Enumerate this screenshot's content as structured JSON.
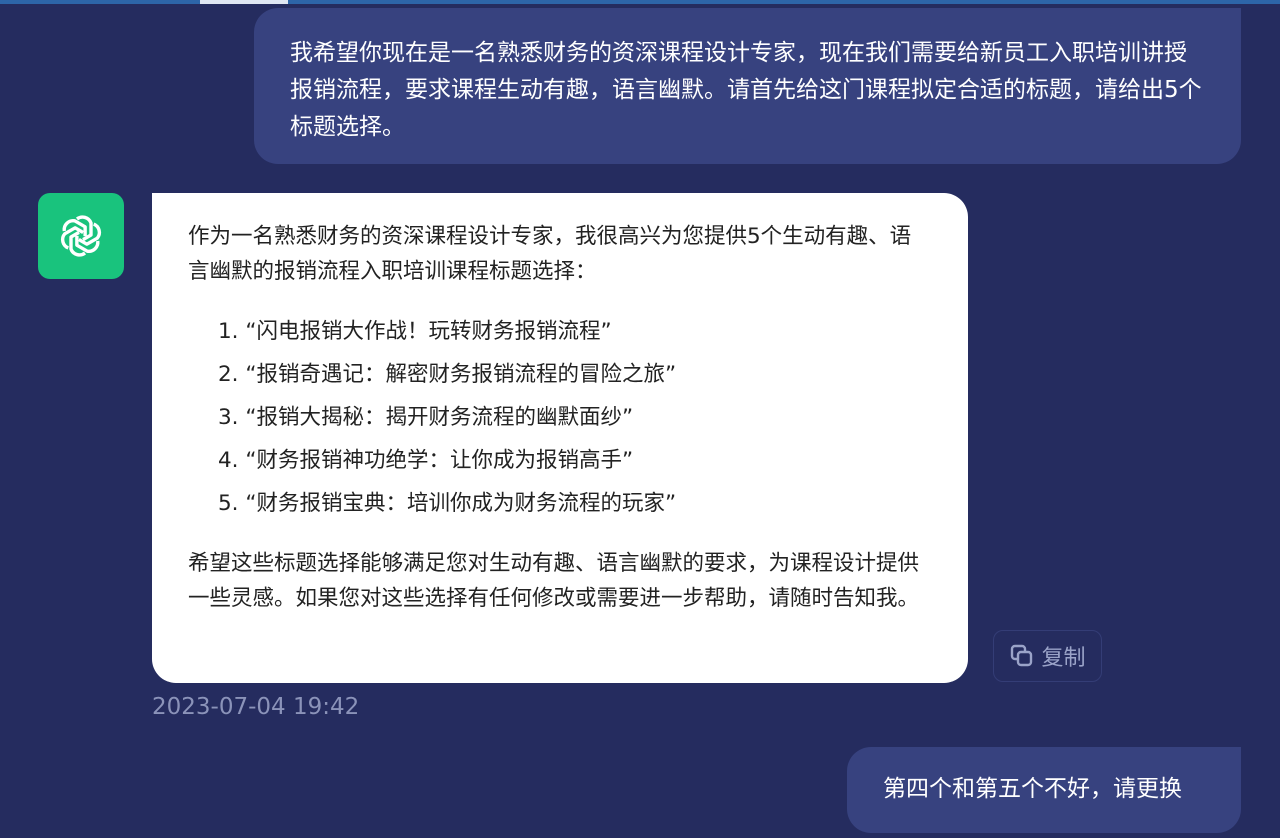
{
  "messages": {
    "user_1": "我希望你现在是一名熟悉财务的资深课程设计专家，现在我们需要给新员工入职培训讲授 报销流程，要求课程生动有趣，语言幽默。请首先给这门课程拟定合适的标题，请给出5个标题选择。",
    "assistant": {
      "intro": "作为一名熟悉财务的资深课程设计专家，我很高兴为您提供5个生动有趣、语言幽默的报销流程入职培训课程标题选择：",
      "items": [
        "1. “闪电报销大作战！玩转财务报销流程”",
        "2. “报销奇遇记：解密财务报销流程的冒险之旅”",
        "3. “报销大揭秘：揭开财务流程的幽默面纱”",
        "4. “财务报销神功绝学：让你成为报销高手”",
        "5. “财务报销宝典：培训你成为财务流程的玩家”"
      ],
      "outro": "希望这些标题选择能够满足您对生动有趣、语言幽默的要求，为课程设计提供一些灵感。如果您对这些选择有任何修改或需要进一步帮助，请随时告知我。",
      "avatar_icon": "openai-logo-icon",
      "timestamp": "2023-07-04 19:42"
    },
    "user_2": "第四个和第五个不好，请更换"
  },
  "actions": {
    "copy_label": "复制",
    "copy_icon": "copy-icon"
  },
  "colors": {
    "background": "#252c5f",
    "user_bubble": "#37427f",
    "assistant_bubble": "#ffffff",
    "avatar_bg": "#19c37d"
  }
}
